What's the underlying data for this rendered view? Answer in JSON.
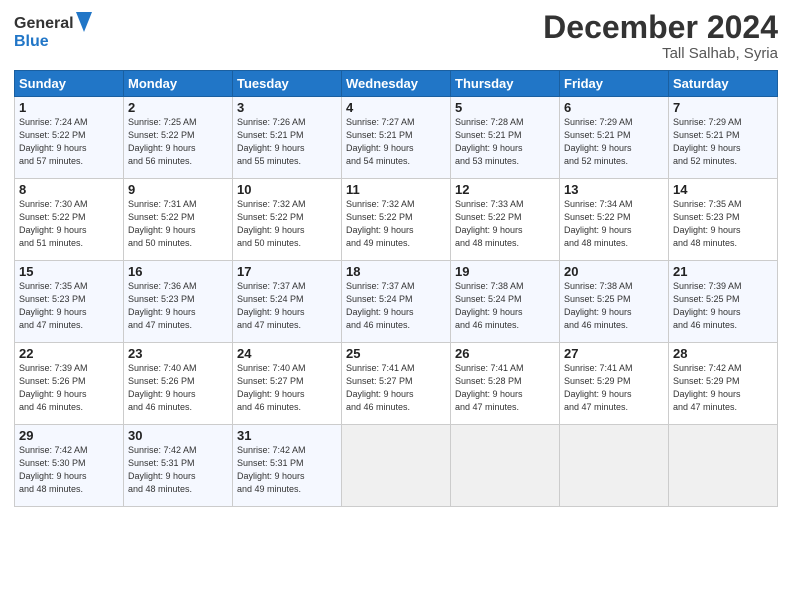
{
  "header": {
    "logo_line1": "General",
    "logo_line2": "Blue",
    "month_title": "December 2024",
    "location": "Tall Salhab, Syria"
  },
  "weekdays": [
    "Sunday",
    "Monday",
    "Tuesday",
    "Wednesday",
    "Thursday",
    "Friday",
    "Saturday"
  ],
  "weeks": [
    [
      {
        "day": "1",
        "lines": [
          "Sunrise: 7:24 AM",
          "Sunset: 5:22 PM",
          "Daylight: 9 hours",
          "and 57 minutes."
        ]
      },
      {
        "day": "2",
        "lines": [
          "Sunrise: 7:25 AM",
          "Sunset: 5:22 PM",
          "Daylight: 9 hours",
          "and 56 minutes."
        ]
      },
      {
        "day": "3",
        "lines": [
          "Sunrise: 7:26 AM",
          "Sunset: 5:21 PM",
          "Daylight: 9 hours",
          "and 55 minutes."
        ]
      },
      {
        "day": "4",
        "lines": [
          "Sunrise: 7:27 AM",
          "Sunset: 5:21 PM",
          "Daylight: 9 hours",
          "and 54 minutes."
        ]
      },
      {
        "day": "5",
        "lines": [
          "Sunrise: 7:28 AM",
          "Sunset: 5:21 PM",
          "Daylight: 9 hours",
          "and 53 minutes."
        ]
      },
      {
        "day": "6",
        "lines": [
          "Sunrise: 7:29 AM",
          "Sunset: 5:21 PM",
          "Daylight: 9 hours",
          "and 52 minutes."
        ]
      },
      {
        "day": "7",
        "lines": [
          "Sunrise: 7:29 AM",
          "Sunset: 5:21 PM",
          "Daylight: 9 hours",
          "and 52 minutes."
        ]
      }
    ],
    [
      {
        "day": "8",
        "lines": [
          "Sunrise: 7:30 AM",
          "Sunset: 5:22 PM",
          "Daylight: 9 hours",
          "and 51 minutes."
        ]
      },
      {
        "day": "9",
        "lines": [
          "Sunrise: 7:31 AM",
          "Sunset: 5:22 PM",
          "Daylight: 9 hours",
          "and 50 minutes."
        ]
      },
      {
        "day": "10",
        "lines": [
          "Sunrise: 7:32 AM",
          "Sunset: 5:22 PM",
          "Daylight: 9 hours",
          "and 50 minutes."
        ]
      },
      {
        "day": "11",
        "lines": [
          "Sunrise: 7:32 AM",
          "Sunset: 5:22 PM",
          "Daylight: 9 hours",
          "and 49 minutes."
        ]
      },
      {
        "day": "12",
        "lines": [
          "Sunrise: 7:33 AM",
          "Sunset: 5:22 PM",
          "Daylight: 9 hours",
          "and 48 minutes."
        ]
      },
      {
        "day": "13",
        "lines": [
          "Sunrise: 7:34 AM",
          "Sunset: 5:22 PM",
          "Daylight: 9 hours",
          "and 48 minutes."
        ]
      },
      {
        "day": "14",
        "lines": [
          "Sunrise: 7:35 AM",
          "Sunset: 5:23 PM",
          "Daylight: 9 hours",
          "and 48 minutes."
        ]
      }
    ],
    [
      {
        "day": "15",
        "lines": [
          "Sunrise: 7:35 AM",
          "Sunset: 5:23 PM",
          "Daylight: 9 hours",
          "and 47 minutes."
        ]
      },
      {
        "day": "16",
        "lines": [
          "Sunrise: 7:36 AM",
          "Sunset: 5:23 PM",
          "Daylight: 9 hours",
          "and 47 minutes."
        ]
      },
      {
        "day": "17",
        "lines": [
          "Sunrise: 7:37 AM",
          "Sunset: 5:24 PM",
          "Daylight: 9 hours",
          "and 47 minutes."
        ]
      },
      {
        "day": "18",
        "lines": [
          "Sunrise: 7:37 AM",
          "Sunset: 5:24 PM",
          "Daylight: 9 hours",
          "and 46 minutes."
        ]
      },
      {
        "day": "19",
        "lines": [
          "Sunrise: 7:38 AM",
          "Sunset: 5:24 PM",
          "Daylight: 9 hours",
          "and 46 minutes."
        ]
      },
      {
        "day": "20",
        "lines": [
          "Sunrise: 7:38 AM",
          "Sunset: 5:25 PM",
          "Daylight: 9 hours",
          "and 46 minutes."
        ]
      },
      {
        "day": "21",
        "lines": [
          "Sunrise: 7:39 AM",
          "Sunset: 5:25 PM",
          "Daylight: 9 hours",
          "and 46 minutes."
        ]
      }
    ],
    [
      {
        "day": "22",
        "lines": [
          "Sunrise: 7:39 AM",
          "Sunset: 5:26 PM",
          "Daylight: 9 hours",
          "and 46 minutes."
        ]
      },
      {
        "day": "23",
        "lines": [
          "Sunrise: 7:40 AM",
          "Sunset: 5:26 PM",
          "Daylight: 9 hours",
          "and 46 minutes."
        ]
      },
      {
        "day": "24",
        "lines": [
          "Sunrise: 7:40 AM",
          "Sunset: 5:27 PM",
          "Daylight: 9 hours",
          "and 46 minutes."
        ]
      },
      {
        "day": "25",
        "lines": [
          "Sunrise: 7:41 AM",
          "Sunset: 5:27 PM",
          "Daylight: 9 hours",
          "and 46 minutes."
        ]
      },
      {
        "day": "26",
        "lines": [
          "Sunrise: 7:41 AM",
          "Sunset: 5:28 PM",
          "Daylight: 9 hours",
          "and 47 minutes."
        ]
      },
      {
        "day": "27",
        "lines": [
          "Sunrise: 7:41 AM",
          "Sunset: 5:29 PM",
          "Daylight: 9 hours",
          "and 47 minutes."
        ]
      },
      {
        "day": "28",
        "lines": [
          "Sunrise: 7:42 AM",
          "Sunset: 5:29 PM",
          "Daylight: 9 hours",
          "and 47 minutes."
        ]
      }
    ],
    [
      {
        "day": "29",
        "lines": [
          "Sunrise: 7:42 AM",
          "Sunset: 5:30 PM",
          "Daylight: 9 hours",
          "and 48 minutes."
        ]
      },
      {
        "day": "30",
        "lines": [
          "Sunrise: 7:42 AM",
          "Sunset: 5:31 PM",
          "Daylight: 9 hours",
          "and 48 minutes."
        ]
      },
      {
        "day": "31",
        "lines": [
          "Sunrise: 7:42 AM",
          "Sunset: 5:31 PM",
          "Daylight: 9 hours",
          "and 49 minutes."
        ]
      },
      {
        "day": "",
        "lines": []
      },
      {
        "day": "",
        "lines": []
      },
      {
        "day": "",
        "lines": []
      },
      {
        "day": "",
        "lines": []
      }
    ]
  ]
}
